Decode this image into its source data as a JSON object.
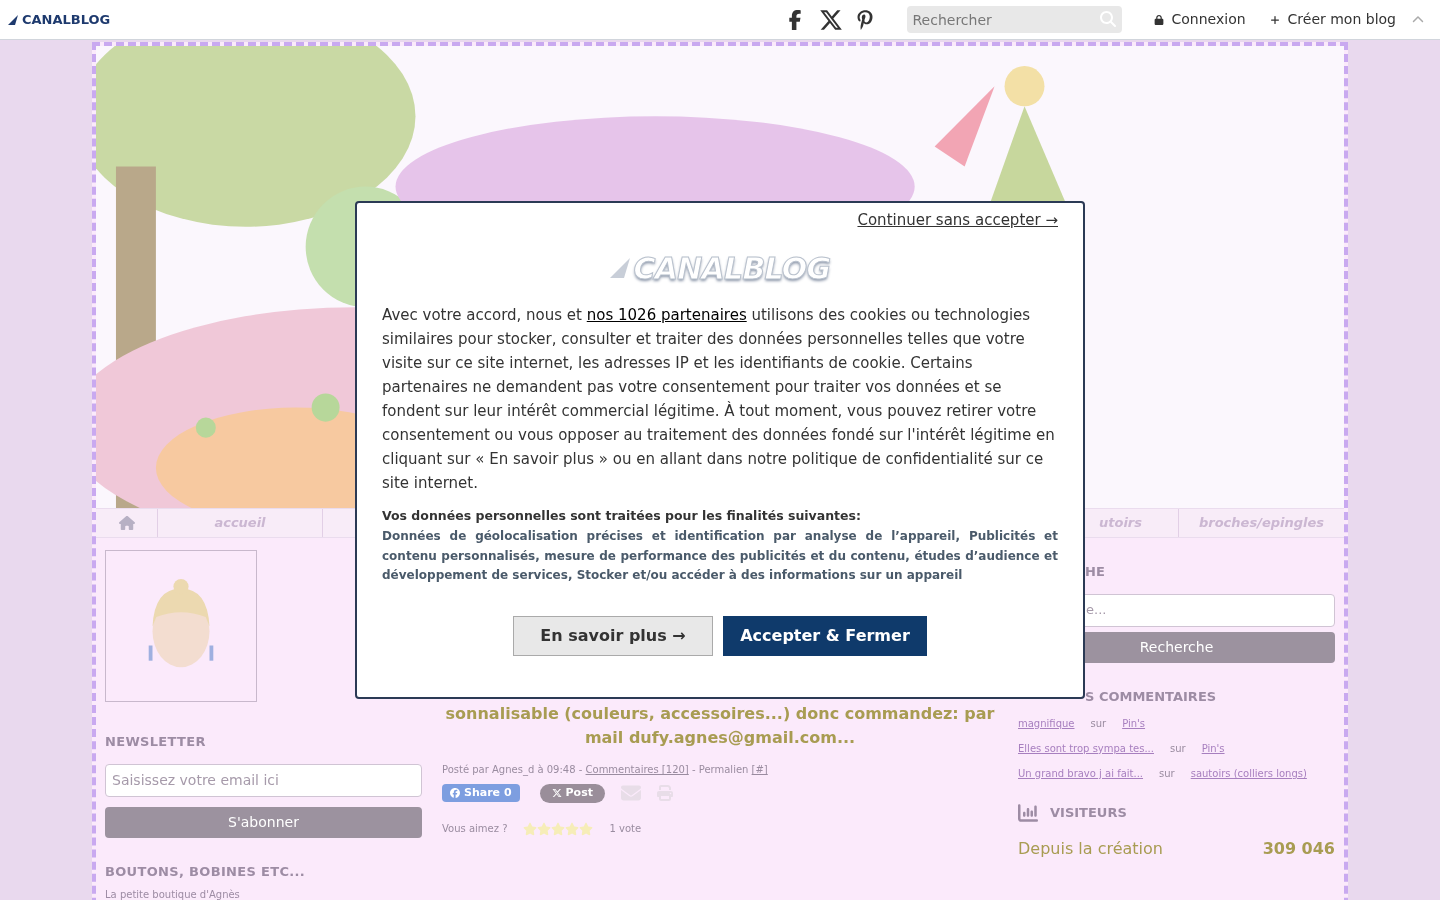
{
  "topbar": {
    "logo": "CANALBLOG",
    "search": {
      "placeholder": "Rechercher"
    },
    "links": [
      {
        "kind": "lock",
        "label": "Connexion"
      },
      {
        "kind": "plus",
        "label": "Créer mon blog"
      }
    ]
  },
  "nav": {
    "items": [
      {
        "kind": "home"
      },
      {
        "kind": "text",
        "label": "accueil"
      }
    ],
    "right_items": [
      "utoirs",
      "broches/epingles"
    ]
  },
  "left": {
    "newsletter": {
      "title": "NEWSLETTER",
      "placeholder": "Saisissez votre email ici",
      "button": "S'abonner"
    },
    "section_title": "BOUTONS, BOBINES ETC...",
    "section_text": "La petite boutique d'Agnès"
  },
  "center": {
    "lines": [
      "sonnalisable (couleurs, accessoires...) donc commandez: par",
      "mail dufy.agnes@gmail.com..."
    ],
    "meta": {
      "before": "Posté par Agnes_d à 09:48 - ",
      "comments": "Commentaires [120]",
      "middle": " - Permalien ",
      "permalink": "[#]"
    },
    "share": "Share 0",
    "post": "Post",
    "like_label": "Vous aimez ?",
    "stars": 5,
    "votes": "1 vote"
  },
  "right": {
    "search_title": "HE",
    "search_placeholder": "e...",
    "search_button": "Recherche",
    "comments_title": "S COMMENTAIRES",
    "comments": [
      {
        "text": "magnifique",
        "sur": "sur",
        "post": "Pin's"
      },
      {
        "text": "Elles sont trop sympa tes...",
        "sur": "sur",
        "post": "Pin's"
      },
      {
        "text": "Un grand bravo j ai fait...",
        "sur": "sur",
        "post": "sautoirs (colliers longs)"
      }
    ],
    "visitors_title": "VISITEURS",
    "visitors_label": "Depuis la création",
    "visitors_count": "309 046"
  },
  "consent": {
    "skip": "Continuer sans accepter →",
    "logo": "CANALBLOG",
    "text_before": "Avec votre accord, nous et ",
    "partners_link": "nos 1026 partenaires",
    "text_after": " utilisons des cookies ou technologies similaires pour stocker, consulter et traiter des données personnelles telles que votre visite sur ce site internet, les adresses IP et les identifiants de cookie. Certains partenaires ne demandent pas votre consentement pour traiter vos données et se fondent sur leur intérêt commercial légitime. À tout moment, vous pouvez retirer votre consentement ou vous opposer au traitement des données fondé sur l'intérêt légitime en cliquant sur « En savoir plus » ou en allant dans notre politique de confidentialité sur ce site internet.",
    "purposes_title": "Vos données personnelles sont traitées pour les finalités suivantes:",
    "purposes": "Données de géolocalisation précises et identification par analyse de l’appareil, Publicités et contenu personnalisés, mesure de performance des publicités et du contenu, études d’audience et développement de services, Stocker et/ou accéder à des informations sur un appareil",
    "learn_more": "En savoir plus →",
    "accept": "Accepter & Fermer"
  }
}
